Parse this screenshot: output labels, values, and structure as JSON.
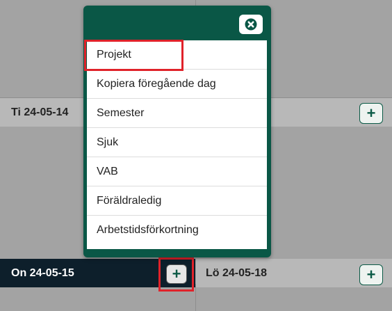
{
  "days": [
    {
      "label": "Ti 24-05-14",
      "add_label": "+"
    },
    {
      "label": "On 24-05-15",
      "add_label": "+"
    },
    {
      "label": "Lö 24-05-18",
      "add_label": "+"
    }
  ],
  "modal": {
    "close_icon": "close-circle-icon",
    "items": [
      "Projekt",
      "Kopiera föregående dag",
      "Semester",
      "Sjuk",
      "VAB",
      "Föräldraledig",
      "Arbetstidsförkortning"
    ]
  },
  "colors": {
    "modal_green": "#0a5746",
    "highlight_red": "#e0222a",
    "selected_day": "#0d1f2b"
  }
}
